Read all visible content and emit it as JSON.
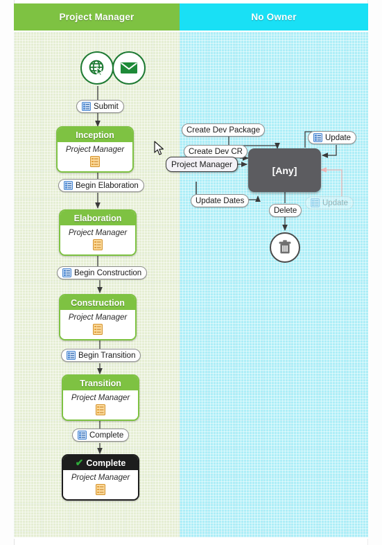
{
  "lanes": [
    {
      "id": "project-manager",
      "title": "Project Manager",
      "color": "#7ec242"
    },
    {
      "id": "no-owner",
      "title": "No Owner",
      "color": "#19e0f5"
    }
  ],
  "start_nodes": [
    {
      "id": "web-start",
      "icon": "globe-cursor-icon"
    },
    {
      "id": "mail-start",
      "icon": "envelope-icon"
    }
  ],
  "states": [
    {
      "id": "inception",
      "title": "Inception",
      "owner": "Project Manager",
      "style": "green",
      "check": ""
    },
    {
      "id": "elaboration",
      "title": "Elaboration",
      "owner": "Project Manager",
      "style": "green",
      "check": ""
    },
    {
      "id": "construction",
      "title": "Construction",
      "owner": "Project Manager",
      "style": "green",
      "check": ""
    },
    {
      "id": "transition",
      "title": "Transition",
      "owner": "Project Manager",
      "style": "green",
      "check": ""
    },
    {
      "id": "complete",
      "title": "Complete",
      "owner": "Project Manager",
      "style": "black",
      "check": "✔"
    }
  ],
  "transitions_left": [
    {
      "id": "submit",
      "label": "Submit"
    },
    {
      "id": "begin-elaboration",
      "label": "Begin Elaboration"
    },
    {
      "id": "begin-construction",
      "label": "Begin Construction"
    },
    {
      "id": "begin-transition",
      "label": "Begin Transition"
    },
    {
      "id": "complete",
      "label": "Complete"
    }
  ],
  "any_node": {
    "label": "[Any]"
  },
  "transitions_right": [
    {
      "id": "create-dev-package",
      "label": "Create Dev Package",
      "icon": false
    },
    {
      "id": "create-dev-cr",
      "label": "Create Dev CR",
      "icon": false
    },
    {
      "id": "update-dates",
      "label": "Update Dates",
      "icon": false
    },
    {
      "id": "delete",
      "label": "Delete",
      "icon": false
    },
    {
      "id": "update",
      "label": "Update",
      "icon": true
    }
  ],
  "drag_ghost": {
    "label": "Update"
  },
  "tooltip": {
    "label": "Project Manager"
  },
  "end_node": {
    "id": "delete-end",
    "icon": "trash-icon"
  },
  "colors": {
    "lane_green": "#7ec242",
    "lane_cyan": "#19e0f5",
    "canvas_green": "#e5eed3",
    "canvas_cyan": "#adeef7",
    "any_gray": "#5c5c60",
    "complete_black": "#1d1d1d",
    "checkmark_green": "#2faa3a",
    "doc_icon_orange": "#f0a93b",
    "list_icon_blue": "#3c7fd0"
  }
}
